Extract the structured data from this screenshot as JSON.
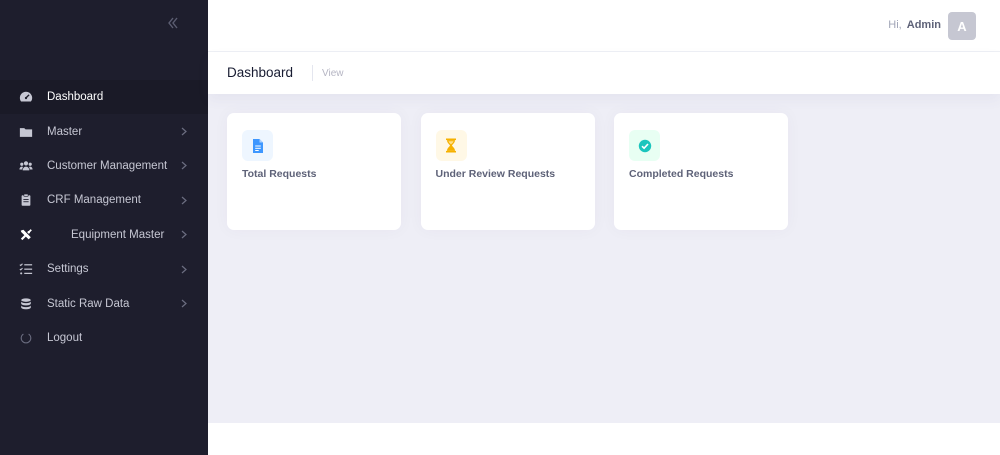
{
  "sidebar": {
    "items": [
      {
        "label": "Dashboard",
        "icon": "tachometer-icon",
        "active": true,
        "has_children": false
      },
      {
        "label": "Master",
        "icon": "folder-icon",
        "active": false,
        "has_children": true
      },
      {
        "label": "Customer Management",
        "icon": "users-icon",
        "active": false,
        "has_children": true
      },
      {
        "label": "CRF Management",
        "icon": "clipboard-icon",
        "active": false,
        "has_children": true
      },
      {
        "label": "Equipment Master",
        "icon": "tools-icon",
        "active": false,
        "has_children": true
      },
      {
        "label": "Settings",
        "icon": "tasks-icon",
        "active": false,
        "has_children": true
      },
      {
        "label": "Static Raw Data",
        "icon": "database-icon",
        "active": false,
        "has_children": true
      },
      {
        "label": "Logout",
        "icon": "power-icon",
        "active": false,
        "has_children": false
      }
    ]
  },
  "header": {
    "greeting": "Hi,",
    "user_name": "Admin",
    "avatar_initial": "A"
  },
  "subheader": {
    "title": "Dashboard",
    "subtitle": "View"
  },
  "cards": [
    {
      "label": "Total Requests",
      "icon": "file-icon",
      "icon_color": "#3e97ff",
      "icon_bg": "#eef6ff"
    },
    {
      "label": "Under Review Requests",
      "icon": "hourglass-icon",
      "icon_color": "#f6b100",
      "icon_bg": "#fff8e6"
    },
    {
      "label": "Completed Requests",
      "icon": "check-circle-icon",
      "icon_color": "#1bc5bd",
      "icon_bg": "#e8fff3"
    }
  ],
  "colors": {
    "sidebar_bg": "#1e1e2d",
    "content_bg": "#eeeef6",
    "accent": "#3e97ff"
  }
}
